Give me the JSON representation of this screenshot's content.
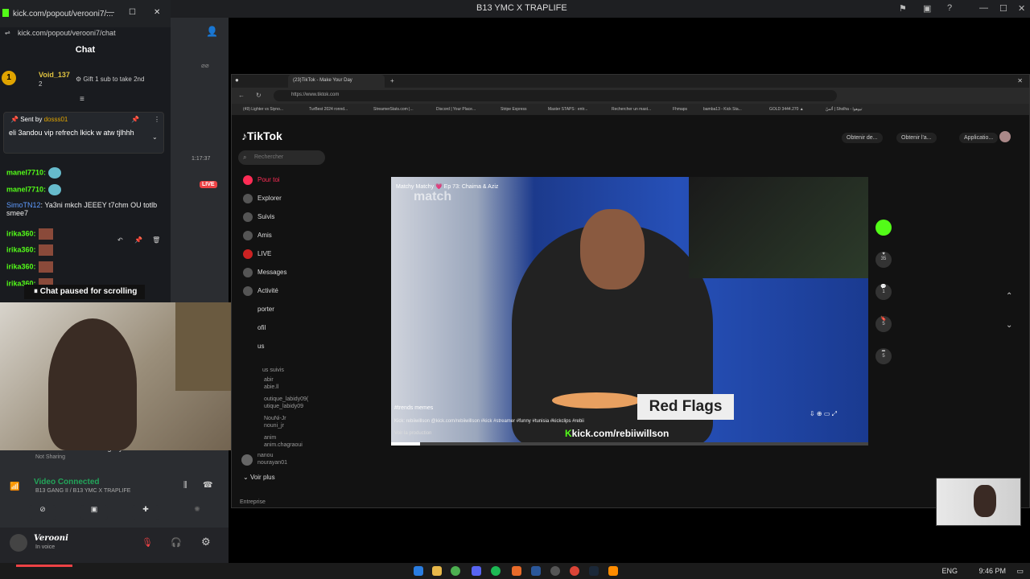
{
  "discord_title": "B13 YMC X TRAPLIFE",
  "chat_window": {
    "title": "kick.com/popout/verooni7/...",
    "url": "kick.com/popout/verooni7/chat",
    "header": "Chat",
    "leader_name": "Void_137",
    "leader_count": "2",
    "gift_text": "Gift 1 sub to take 2nd",
    "pinned_sent_by": "Sent by",
    "pinned_user": "dosss01",
    "pinned_text": "eli 3andou vip refrech lkick w atw tjlhhh",
    "messages": [
      {
        "user": "manel7710:",
        "text": ""
      },
      {
        "user": "manel7710:",
        "text": ""
      },
      {
        "user": "SimoTN12",
        "text": ": Ya3ni mkch JEEEY t7chm OU totlb smee7"
      },
      {
        "user": "irika360:",
        "text": ""
      },
      {
        "user": "irika360:",
        "text": ""
      },
      {
        "user": "irika360:",
        "text": ""
      },
      {
        "user": "irika360:",
        "text": ""
      }
    ],
    "paused": "Chat paused for scrolling",
    "badge_one": "1"
  },
  "discord": {
    "timer": "1:17:37",
    "live_badge": "LIVE",
    "game_title": "Grand Theft Auto V Legacy",
    "game_sub": "Not Sharing",
    "voice_status": "Video Connected",
    "voice_channel": "B13 GANG II / B13 YMC X TRAPLIFE",
    "username": "Verooni",
    "user_status": "In voice"
  },
  "browser": {
    "tab_title": "(23)TikTok - Make Your Day",
    "address": "https://www.tiktok.com",
    "bookmarks": [
      "(49) Lighter vs Siyno...",
      "TurBest 2024 ronnd...",
      "StreamerStats.com |...",
      "Discord | Your Place...",
      "Stripe Express",
      "Master STAPS : entr...",
      "Rechercher un mast...",
      "Fhmaps",
      "bamba13 - Kick Sta...",
      "GOLD 3444.270 ▲",
      "ألسّ | Sholha - تيوهوا"
    ]
  },
  "tiktok": {
    "logo": "TikTok",
    "search_placeholder": "Rechercher",
    "nav": [
      "Pour toi",
      "Explorer",
      "Suivis",
      "Amis",
      "LIVE",
      "Messages",
      "Activité",
      "porter",
      "ofil",
      "us"
    ],
    "following_label": "us suivis",
    "following": [
      "abir",
      "abie.ll",
      "outique_labidy09(",
      "utique_labidy09",
      "NouNi-Jr",
      "nouni_jr",
      "anim",
      "anim.chagraoui",
      "nanou",
      "nourayan01"
    ],
    "see_more": "Voir plus",
    "enterprise": "Entreprise",
    "top_buttons": [
      "Obtenir de...",
      "Obtenir l'a...",
      "Applicatio..."
    ],
    "video_caption_top": "Matchy Matchy 💗 Ep 73: Chaima & Aziz",
    "video_watermark": "match",
    "red_flags": "Red Flags",
    "kick_url": "kick.com/rebiiwillson",
    "hashtags": "Kick: rebiiwillson  @kick.com/rebiiwillson #kick #streamer #funny #tunisia #kickclips #rebii",
    "memes_label": "#trends memes",
    "production": "Voir la production",
    "action_counts": [
      "35",
      "1",
      "5",
      "5"
    ]
  },
  "taskbar": {
    "lang": "ENG",
    "time": "9:46 PM"
  }
}
